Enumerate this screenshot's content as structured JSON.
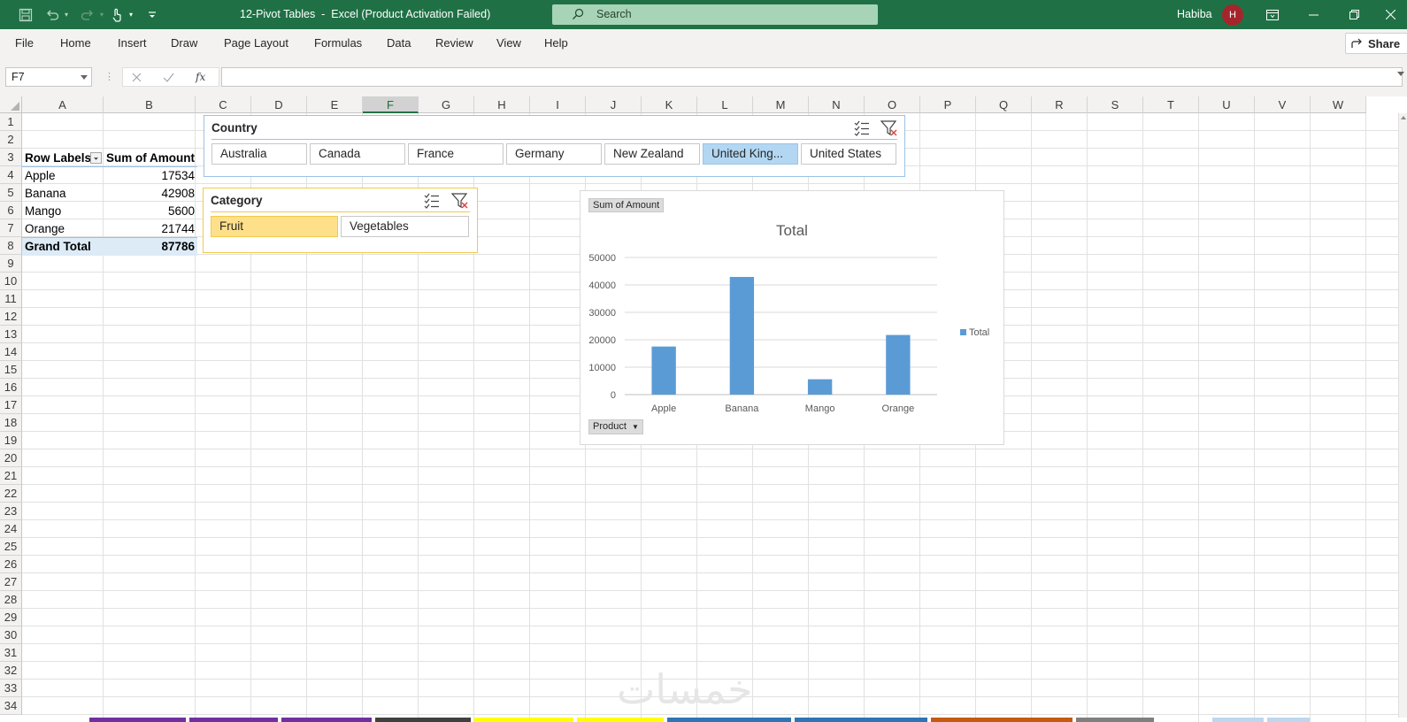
{
  "window": {
    "title": "12-Pivot Tables  -  Excel (Product Activation Failed)",
    "search_placeholder": "Search",
    "user_name": "Habiba",
    "user_initial": "H"
  },
  "menu": {
    "items": [
      "File",
      "Home",
      "Insert",
      "Draw",
      "Page Layout",
      "Formulas",
      "Data",
      "Review",
      "View",
      "Help"
    ],
    "share_label": "Share"
  },
  "formula_bar": {
    "name_box": "F7",
    "fx_label": "fx",
    "formula": ""
  },
  "grid": {
    "columns": [
      "A",
      "B",
      "C",
      "D",
      "E",
      "F",
      "G",
      "H",
      "I",
      "J",
      "K",
      "L",
      "M",
      "N",
      "O",
      "P",
      "Q",
      "R",
      "S",
      "T",
      "U",
      "V",
      "W"
    ],
    "active_column": "F",
    "rows": [
      "1",
      "2",
      "3",
      "4",
      "5",
      "6",
      "7",
      "8",
      "9",
      "10",
      "11",
      "12",
      "13",
      "14",
      "15",
      "16",
      "17",
      "18",
      "19",
      "20",
      "21",
      "22",
      "23",
      "24",
      "25",
      "26",
      "27",
      "28",
      "29",
      "30",
      "31",
      "32",
      "33",
      "34"
    ]
  },
  "pivot_table": {
    "header_row_labels": "Row Labels",
    "header_sum": "Sum of Amount",
    "rows": [
      {
        "label": "Apple",
        "value": "17534"
      },
      {
        "label": "Banana",
        "value": "42908"
      },
      {
        "label": "Mango",
        "value": "5600"
      },
      {
        "label": "Orange",
        "value": "21744"
      }
    ],
    "grand_total_label": "Grand Total",
    "grand_total_value": "87786"
  },
  "slicers": {
    "country": {
      "title": "Country",
      "items": [
        "Australia",
        "Canada",
        "France",
        "Germany",
        "New Zealand",
        "United King...",
        "United States"
      ],
      "selected": "United King..."
    },
    "category": {
      "title": "Category",
      "items": [
        "Fruit",
        "Vegetables"
      ],
      "selected": "Fruit"
    }
  },
  "pivot_chart": {
    "value_field_button": "Sum of Amount",
    "axis_field_button": "Product",
    "bar_color": "#5b9bd5"
  },
  "chart_data": {
    "type": "bar",
    "title": "Total",
    "categories": [
      "Apple",
      "Banana",
      "Mango",
      "Orange"
    ],
    "series": [
      {
        "name": "Total",
        "values": [
          17534,
          42908,
          5600,
          21744
        ]
      }
    ],
    "ylim": [
      0,
      50000
    ],
    "yticks": [
      "0",
      "10000",
      "20000",
      "30000",
      "40000",
      "50000"
    ],
    "legend_position": "right",
    "grid": true
  },
  "watermark": "خمسات",
  "colors": {
    "title_bar": "#1f7145",
    "slicer_selected_country": "#b3d7f2",
    "slicer_selected_category": "#ffe08a",
    "category_slicer_border": "#f2c94c"
  }
}
